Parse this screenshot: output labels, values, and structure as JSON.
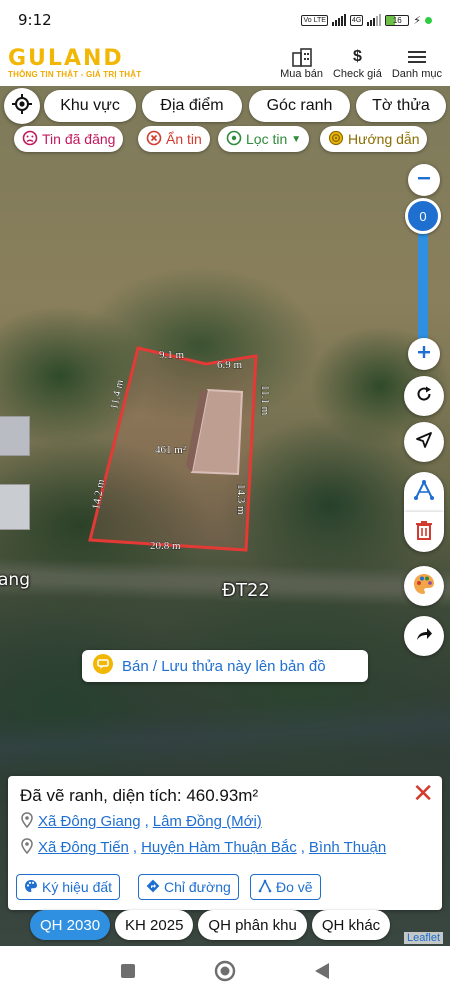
{
  "status_bar": {
    "time": "9:12",
    "net_chip_1": "Vo LTE",
    "net_chip_2": "4G",
    "battery": "16"
  },
  "header": {
    "logo_text": "GULAND",
    "tagline": "THÔNG TIN THẬT - GIÁ TRỊ THẬT",
    "nav": [
      {
        "label": "Mua bán",
        "icon": "building-icon"
      },
      {
        "label": "Check giá",
        "icon": "dollar-icon"
      },
      {
        "label": "Danh mục",
        "icon": "menu-icon"
      }
    ]
  },
  "filters": {
    "khu_vuc": "Khu vực",
    "dia_diem": "Địa điểm",
    "goc_ranh": "Góc ranh",
    "to_thua": "Tờ thửa"
  },
  "tags": {
    "tin_da_dang": "Tin đã đăng",
    "an_tin": "Ẩn tin",
    "loc_tin": "Lọc tin",
    "huong_dan": "Hướng dẫn"
  },
  "map": {
    "zoom_value": "0",
    "parcel": {
      "edge_top_left": "9.1 m",
      "edge_top_right": "6.9 m",
      "edge_left_top": "11.4 m",
      "edge_right_top": "11.1 m",
      "edge_left_bottom": "14.2 m",
      "edge_right_bottom": "14.3 m",
      "edge_bottom": "20.8 m",
      "area": "461 m²"
    },
    "road_label": "ĐT22",
    "place_label": "ang",
    "attribution": "Leaflet",
    "colors": {
      "parcel_outline": "#e53935",
      "accent_blue": "#1f6fd1"
    }
  },
  "save_banner": "Bán / Lưu thửa này lên bản đồ",
  "info_panel": {
    "title": "Đã vẽ ranh, diện tích: 460.93m²",
    "location_new": {
      "commune": "Xã Đông Giang",
      "province": "Lâm Đồng (Mới)"
    },
    "location_old": {
      "commune": "Xã Đông Tiến",
      "district": "Huyện Hàm Thuận Bắc",
      "province": "Bình Thuận"
    },
    "actions": {
      "ky_hieu_dat": "Ký hiệu đất",
      "chi_duong": "Chỉ đường",
      "do_ve": "Đo vẽ"
    }
  },
  "planning_tabs": [
    {
      "label": "QH 2030",
      "active": true
    },
    {
      "label": "KH 2025",
      "active": false
    },
    {
      "label": "QH phân khu",
      "active": false
    },
    {
      "label": "QH khác",
      "active": false
    }
  ]
}
